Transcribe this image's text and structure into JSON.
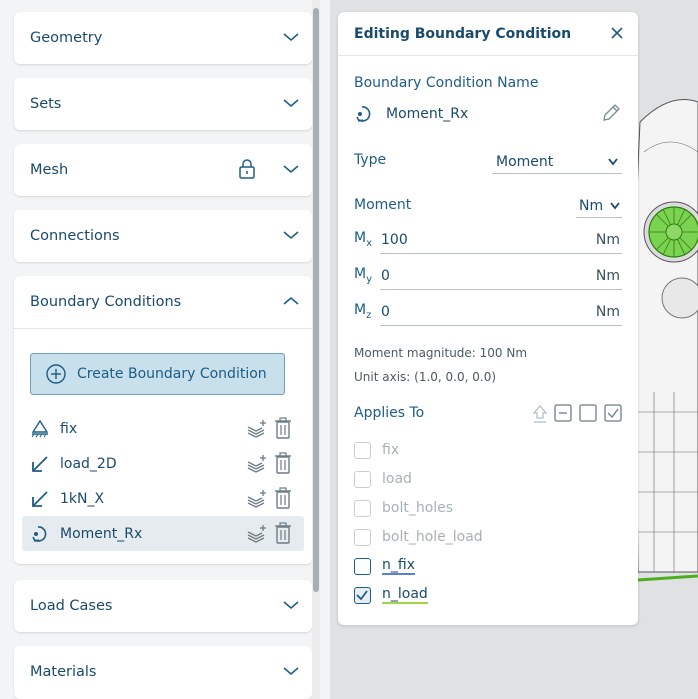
{
  "sidebar": {
    "panels": [
      {
        "title": "Geometry"
      },
      {
        "title": "Sets"
      },
      {
        "title": "Mesh"
      },
      {
        "title": "Connections"
      },
      {
        "title": "Boundary Conditions"
      },
      {
        "title": "Load Cases"
      },
      {
        "title": "Materials"
      }
    ],
    "create_button_label": "Create Boundary Condition",
    "boundary_conditions": [
      {
        "name": "fix",
        "icon": "fixed-support-icon"
      },
      {
        "name": "load_2D",
        "icon": "force-arrow-icon"
      },
      {
        "name": "1kN_X",
        "icon": "force-arrow-icon"
      },
      {
        "name": "Moment_Rx",
        "icon": "moment-icon",
        "selected": true
      }
    ]
  },
  "editor": {
    "title": "Editing Boundary Condition",
    "name_label": "Boundary Condition Name",
    "name_value": "Moment_Rx",
    "type_label": "Type",
    "type_value": "Moment",
    "moment_label": "Moment",
    "moment_unit": "Nm",
    "components": [
      {
        "label": "M",
        "sub": "x",
        "value": "100",
        "unit": "Nm"
      },
      {
        "label": "M",
        "sub": "y",
        "value": "0",
        "unit": "Nm"
      },
      {
        "label": "M",
        "sub": "z",
        "value": "0",
        "unit": "Nm"
      }
    ],
    "magnitude_text": "Moment magnitude: 100 Nm",
    "unit_axis_text": "Unit axis: (1.0, 0.0, 0.0)",
    "applies_to_label": "Applies To",
    "sets": [
      {
        "name": "fix",
        "enabled": false,
        "checked": false
      },
      {
        "name": "load",
        "enabled": false,
        "checked": false
      },
      {
        "name": "bolt_holes",
        "enabled": false,
        "checked": false
      },
      {
        "name": "bolt_hole_load",
        "enabled": false,
        "checked": false
      },
      {
        "name": "n_fix",
        "enabled": true,
        "checked": false,
        "underline_color": "#5b7fd6"
      },
      {
        "name": "n_load",
        "enabled": true,
        "checked": true,
        "underline_color": "#9fd64a"
      }
    ]
  },
  "colors": {
    "accent": "#1d5d87",
    "title": "#1a4a6e",
    "button_bg": "#c8dfec",
    "mesh_green": "#4caf22"
  }
}
